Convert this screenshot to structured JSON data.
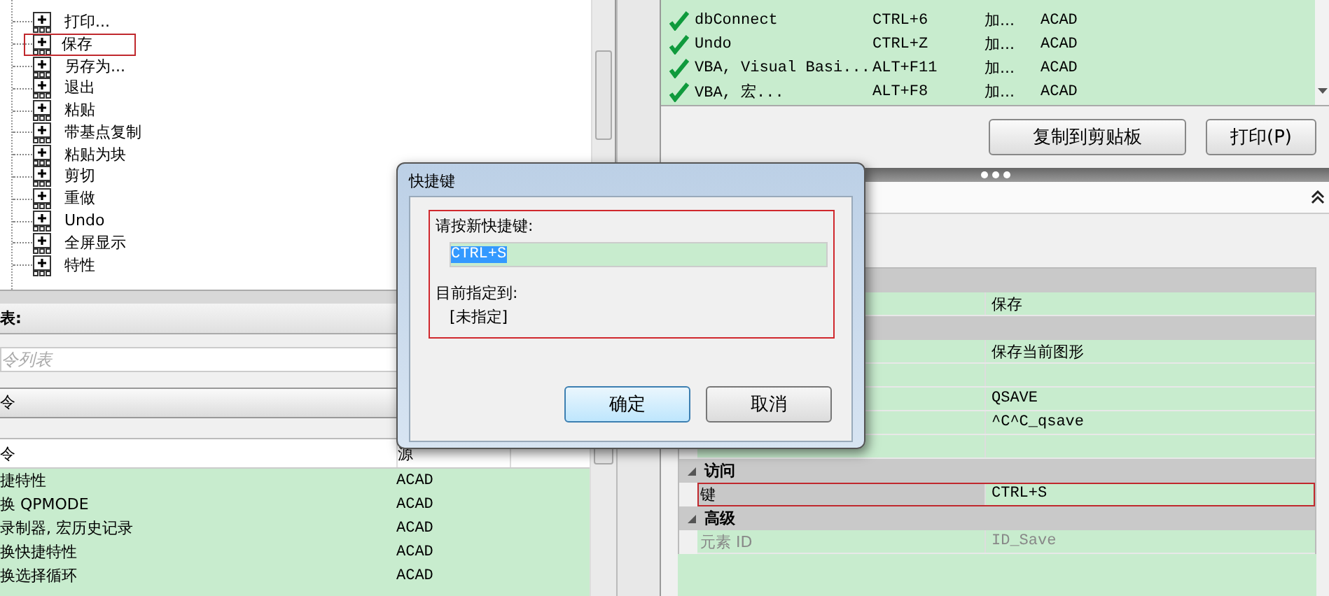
{
  "tree": {
    "items": [
      {
        "label": "打印...",
        "marked": false
      },
      {
        "label": "保存",
        "marked": true
      },
      {
        "label": "另存为...",
        "marked": false
      },
      {
        "label": "退出",
        "marked": false
      },
      {
        "label": "粘贴",
        "marked": false
      },
      {
        "label": "带基点复制",
        "marked": false
      },
      {
        "label": "粘贴为块",
        "marked": false
      },
      {
        "label": "剪切",
        "marked": false
      },
      {
        "label": "重做",
        "marked": false
      },
      {
        "label": "Undo",
        "marked": false
      },
      {
        "label": "全屏显示",
        "marked": false
      },
      {
        "label": "特性",
        "marked": false
      }
    ]
  },
  "command_list": {
    "title": "表:",
    "search": {
      "placeholder": "令列表"
    },
    "filter": {
      "value": "令"
    },
    "columns": [
      "令",
      "源"
    ],
    "rows": [
      {
        "name": "捷特性",
        "source": "ACAD"
      },
      {
        "name": "换 QPMODE",
        "source": "ACAD"
      },
      {
        "name": "录制器, 宏历史记录",
        "source": "ACAD"
      },
      {
        "name": "换快捷特性",
        "source": "ACAD"
      },
      {
        "name": "换选择循环",
        "source": "ACAD"
      }
    ]
  },
  "shortcut_list": {
    "rows": [
      {
        "command": "dbConnect",
        "keys": "CTRL+6",
        "type": "加...",
        "source": "ACAD"
      },
      {
        "command": "Undo",
        "keys": "CTRL+Z",
        "type": "加...",
        "source": "ACAD"
      },
      {
        "command": "VBA, Visual Basi...",
        "keys": "ALT+F11",
        "type": "加...",
        "source": "ACAD"
      },
      {
        "command": "VBA, 宏...",
        "keys": "ALT+F8",
        "type": "加...",
        "source": "ACAD"
      }
    ]
  },
  "buttons": [
    "复制到剪贴板",
    "打印(P)"
  ],
  "properties": {
    "rows": [
      {
        "kind": "category"
      },
      {
        "kind": "row",
        "value": "保存",
        "selected": false,
        "disabled": false,
        "marked": false
      },
      {
        "kind": "category"
      },
      {
        "kind": "row",
        "value": "保存当前图形",
        "selected": false,
        "disabled": false,
        "marked": false
      },
      {
        "kind": "row"
      },
      {
        "kind": "row",
        "value": "QSAVE",
        "selected": false,
        "disabled": false,
        "marked": false
      },
      {
        "kind": "row",
        "value": "^C^C_qsave",
        "selected": false,
        "disabled": false,
        "marked": false
      },
      {
        "kind": "row"
      },
      {
        "kind": "category",
        "label": "访问"
      },
      {
        "kind": "row",
        "name": "键",
        "value": "CTRL+S",
        "selected": true,
        "disabled": false,
        "marked": true
      },
      {
        "kind": "category",
        "label": "高级"
      },
      {
        "kind": "row",
        "name": "元素 ID",
        "value": "ID_Save",
        "selected": false,
        "disabled": true,
        "marked": false
      }
    ]
  },
  "dialog": {
    "title": "快捷键",
    "prompt": "请按新快捷键:",
    "value": "CTRL+S",
    "current_label": "目前指定到:",
    "current_value": "[未指定]",
    "marked": true,
    "buttons": [
      {
        "label": "确定",
        "default": true
      },
      {
        "label": "取消",
        "default": false
      }
    ]
  }
}
